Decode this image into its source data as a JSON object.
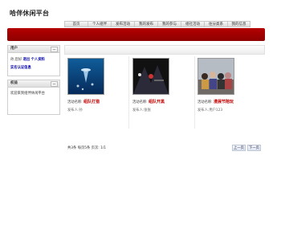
{
  "site_title": "哈伴休闲平台",
  "nav": [
    "首页",
    "个人组伴",
    "发布活动",
    "我的发布",
    "我的参与",
    "组社活动",
    "往分类系",
    "我的信息"
  ],
  "user_panel": {
    "title": "用户",
    "collapse": "—",
    "greeting_prefix": "孙,您好",
    "logout": "退出",
    "profile": "个人资料",
    "verify": "实名认证信息"
  },
  "help_panel": {
    "title": "权益",
    "collapse": "—",
    "welcome": "欢迎来到组伴休闲平台"
  },
  "activities": [
    {
      "label": "活动名称:",
      "name": "组队打猎",
      "publisher": "发布人:孙"
    },
    {
      "label": "活动名称:",
      "name": "组队开黑",
      "publisher": "发布人:张张"
    },
    {
      "label": "活动名称:",
      "name": "漫展节陪玩",
      "publisher": "发布人:用户123"
    }
  ],
  "pagination": {
    "info": "共3条  每页5条  页次: 1/1",
    "prev": "上一页",
    "next": "下一页"
  },
  "colors": {
    "banner": "#a00000",
    "title_red": "#c00000",
    "link_blue": "#0000aa"
  }
}
